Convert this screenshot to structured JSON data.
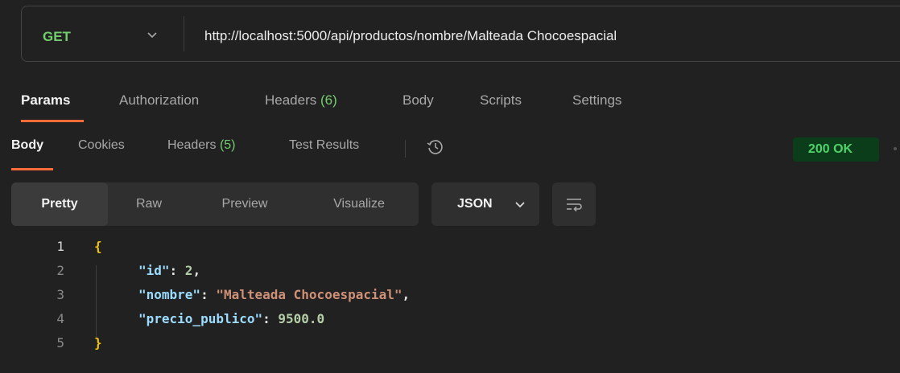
{
  "request": {
    "method": "GET",
    "url": "http://localhost:5000/api/productos/nombre/Malteada Chocoespacial"
  },
  "request_tabs": {
    "params": "Params",
    "authorization": "Authorization",
    "headers": "Headers",
    "headers_count": "(6)",
    "body": "Body",
    "scripts": "Scripts",
    "settings": "Settings"
  },
  "response_tabs": {
    "body": "Body",
    "cookies": "Cookies",
    "headers": "Headers",
    "headers_count": "(5)",
    "test_results": "Test Results",
    "history_icon": "history-icon"
  },
  "status": "200 OK",
  "view_modes": {
    "pretty": "Pretty",
    "raw": "Raw",
    "preview": "Preview",
    "visualize": "Visualize"
  },
  "format": "JSON",
  "code_lines": [
    {
      "n": "1",
      "text": "{"
    },
    {
      "n": "2",
      "key": "\"id\"",
      "value": "2",
      "suffix": ","
    },
    {
      "n": "3",
      "key": "\"nombre\"",
      "value": "\"Malteada Chocoespacial\"",
      "suffix": ","
    },
    {
      "n": "4",
      "key": "\"precio_publico\"",
      "value": "9500.0",
      "suffix": ""
    },
    {
      "n": "5",
      "text": "}"
    }
  ],
  "colors": {
    "accent": "#ff6c37",
    "method_get": "#73cd6e",
    "status_ok": "#4fd36a"
  }
}
